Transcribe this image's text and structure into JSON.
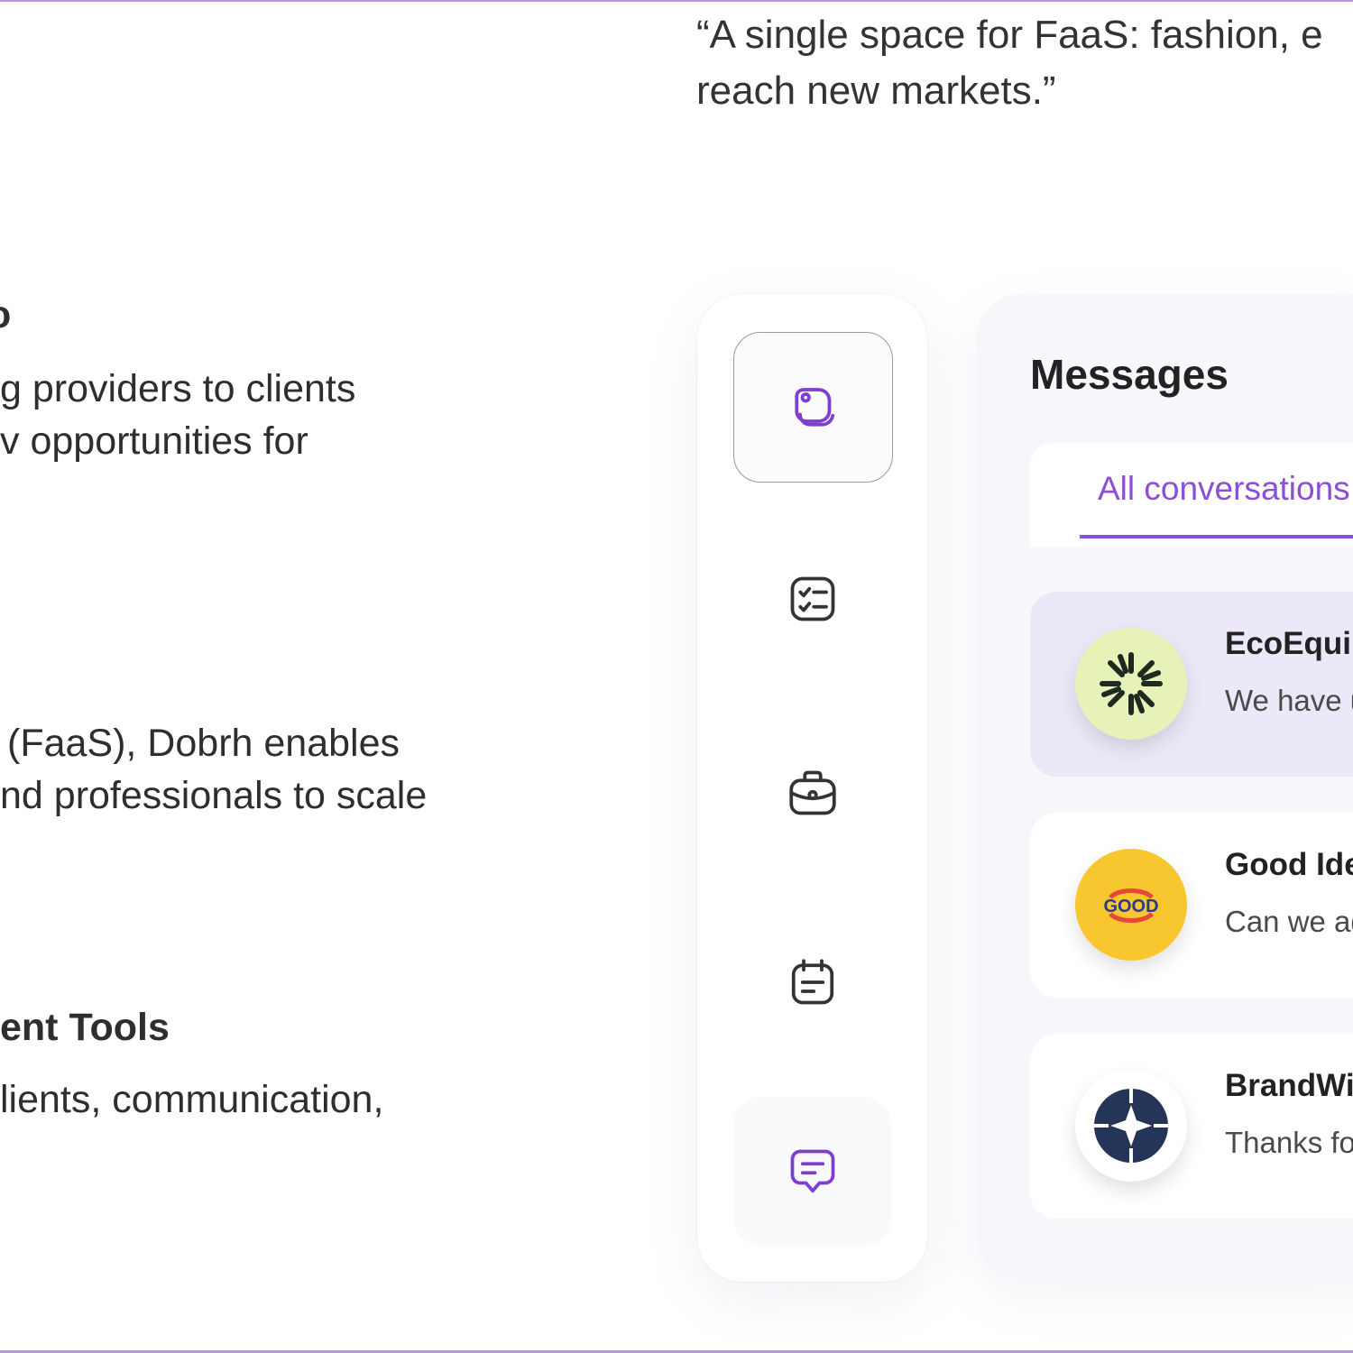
{
  "quote": {
    "line1": "“A single space for FaaS: fashion, e",
    "line2": "reach new markets.”"
  },
  "left_copy": {
    "fragment_top": "o",
    "para1_line1": "g providers to clients",
    "para1_line2": "v opportunities for",
    "para2_line1": "(FaaS), Dobrh enables",
    "para2_line2": "nd professionals to scale",
    "heading3": "ent Tools",
    "para3_line1": "lients, communication,"
  },
  "rail": {
    "items": [
      {
        "icon": "wallet-icon",
        "active": true
      },
      {
        "icon": "checklist-icon",
        "active": false
      },
      {
        "icon": "briefcase-icon",
        "active": false
      },
      {
        "icon": "calendar-icon",
        "active": false
      },
      {
        "icon": "chat-icon",
        "active": false
      }
    ]
  },
  "messages": {
    "title": "Messages",
    "tab_label": "All conversations",
    "conversations": [
      {
        "name": "EcoEquip",
        "preview": "We have u",
        "avatar_bg": "#e6f2b8",
        "icon": "sunburst-logo-icon",
        "selected": true
      },
      {
        "name": "Good Ideas",
        "preview": "Can we ad",
        "avatar_bg": "#f8c62e",
        "icon": "good-logo-icon",
        "logo_text": "GOOD",
        "selected": false
      },
      {
        "name": "BrandWise",
        "preview": "Thanks fo",
        "avatar_bg": "#ffffff",
        "icon": "star-compass-logo-icon",
        "selected": false
      }
    ]
  },
  "colors": {
    "accent": "#8b4fd6",
    "selected_row": "#ece8f8",
    "frame": "#b89ad6"
  }
}
